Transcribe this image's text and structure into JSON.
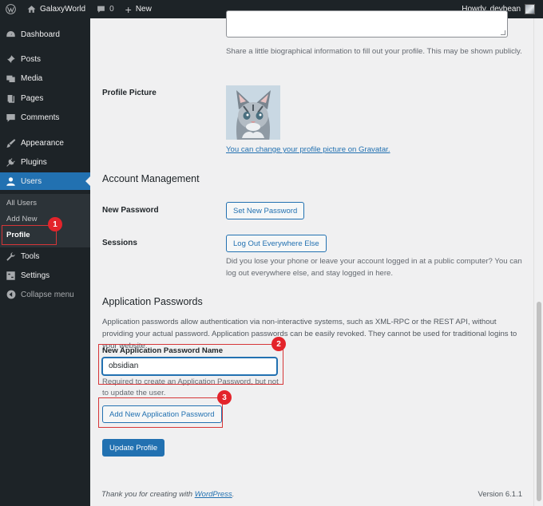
{
  "admin_bar": {
    "site_name": "GalaxyWorld",
    "comments_count": "0",
    "new_label": "New",
    "greeting": "Howdy, devbean"
  },
  "sidebar": {
    "items": [
      {
        "label": "Dashboard",
        "icon": "dashboard-icon"
      },
      {
        "label": "Posts",
        "icon": "pin-icon"
      },
      {
        "label": "Media",
        "icon": "media-icon"
      },
      {
        "label": "Pages",
        "icon": "pages-icon"
      },
      {
        "label": "Comments",
        "icon": "comment-icon"
      },
      {
        "label": "Appearance",
        "icon": "brush-icon"
      },
      {
        "label": "Plugins",
        "icon": "plug-icon"
      },
      {
        "label": "Users",
        "icon": "users-icon"
      },
      {
        "label": "Tools",
        "icon": "wrench-icon"
      },
      {
        "label": "Settings",
        "icon": "settings-icon"
      },
      {
        "label": "Collapse menu",
        "icon": "collapse-icon"
      }
    ],
    "submenu": [
      "All Users",
      "Add New",
      "Profile"
    ]
  },
  "bio": {
    "description": "Share a little biographical information to fill out your profile. This may be shown publicly."
  },
  "profile_picture": {
    "label": "Profile Picture",
    "gravatar_link": "You can change your profile picture on Gravatar."
  },
  "account_management": {
    "title": "Account Management",
    "new_password_label": "New Password",
    "set_new_password_button": "Set New Password",
    "sessions_label": "Sessions",
    "logout_button": "Log Out Everywhere Else",
    "sessions_desc": "Did you lose your phone or leave your account logged in at a public computer? You can log out everywhere else, and stay logged in here."
  },
  "app_passwords": {
    "title": "Application Passwords",
    "intro": "Application passwords allow authentication via non-interactive systems, such as XML-RPC or the REST API, without providing your actual password. Application passwords can be easily revoked. They cannot be used for traditional logins to your website.",
    "name_label": "New Application Password Name",
    "name_value": "obsidian",
    "name_desc": "Required to create an Application Password, but not to update the user.",
    "add_button": "Add New Application Password"
  },
  "update_button": "Update Profile",
  "footer": {
    "thanks_prefix": "Thank you for creating with ",
    "wordpress_link": "WordPress",
    "thanks_suffix": ".",
    "version": "Version 6.1.1"
  },
  "annotations": [
    "1",
    "2",
    "3"
  ],
  "colors": {
    "accent": "#2271b1",
    "admin_bg": "#1d2327",
    "highlight": "#d63638"
  }
}
